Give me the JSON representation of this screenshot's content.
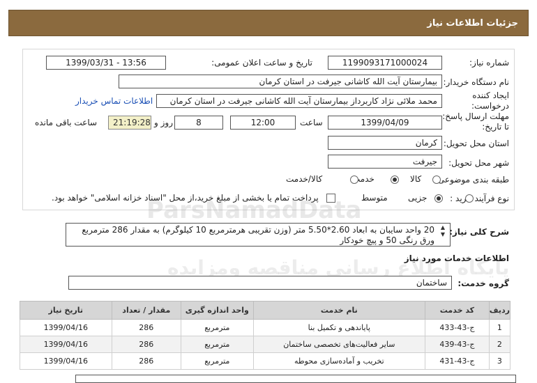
{
  "header": {
    "title": "جزئیات اطلاعات نیاز"
  },
  "form": {
    "need_number": {
      "label": "شماره نیاز:",
      "value": "1199093171000024"
    },
    "announce_datetime": {
      "label": "تاریخ و ساعت اعلان عمومی:",
      "value": "1399/03/31 - 13:56"
    },
    "buyer_org": {
      "label": "نام دستگاه خریدار:",
      "value": "بیمارستان آیت الله کاشانی جیرفت در استان کرمان"
    },
    "creator": {
      "label": "ایجاد کننده درخواست:",
      "value": "محمد ملائی نژاد کاربرداز بیمارستان آیت الله کاشانی جیرفت در استان کرمان",
      "contact_link": "اطلاعات تماس خریدار"
    },
    "deadline": {
      "label": "مهلت ارسال پاسخ: تا تاریخ:",
      "date": "1399/04/09",
      "time_label": "ساعت",
      "time": "12:00",
      "days": "8",
      "days_label": "روز و",
      "remaining": "21:19:28",
      "remaining_label": "ساعت باقی مانده"
    },
    "province": {
      "label": "استان محل تحویل:",
      "value": "کرمان"
    },
    "city": {
      "label": "شهر محل تحویل:",
      "value": "جیرفت"
    },
    "category": {
      "label": "طبقه بندی موضوعی:",
      "options": [
        "کالا",
        "خدمت",
        "کالا/خدمت"
      ],
      "selected": "خدمت"
    },
    "purchase_type": {
      "label": "نوع فرآیند خرید :",
      "options": [
        "جزیی",
        "متوسط"
      ],
      "selected": "متوسط",
      "note": "پرداخت تمام یا بخشی از مبلغ خرید،از محل \"اسناد خزانه اسلامی\" خواهد بود."
    }
  },
  "description": {
    "label": "شرح کلی نیاز:",
    "text": "20 واحد سایبان به ابعاد 2.60*5.50 متر (وزن تقریبی هرمترمربع 10 کیلوگرم) به مقدار 286 مترمربع ورق رنگی 50 و پیچ خودکار"
  },
  "services_section": {
    "title": "اطلاعات خدمات مورد نیاز"
  },
  "service_group": {
    "label": "گروه خدمت:",
    "value": "ساختمان"
  },
  "table": {
    "headers": [
      "ردیف",
      "کد خدمت",
      "نام خدمت",
      "واحد اندازه گیری",
      "مقدار / تعداد",
      "تاریخ نیاز"
    ],
    "rows": [
      [
        "1",
        "ج-43-433",
        "پایاندهی و تکمیل بنا",
        "مترمربع",
        "286",
        "1399/04/16"
      ],
      [
        "2",
        "ج-43-439",
        "سایر فعالیت‌های تخصصی ساختمان",
        "مترمربع",
        "286",
        "1399/04/16"
      ],
      [
        "3",
        "ج-43-431",
        "تخریب و آماده‌سازی محوطه",
        "مترمربع",
        "286",
        "1399/04/16"
      ]
    ]
  },
  "watermark": {
    "line1": "ParsNamadData",
    "line2": "پایگاه اطلاع رسانی مناقصه ومزایده"
  },
  "colors": {
    "header_bg": "#8b6a3e",
    "link": "#1a4fb5",
    "remaining_bg": "#f3f0c8"
  }
}
